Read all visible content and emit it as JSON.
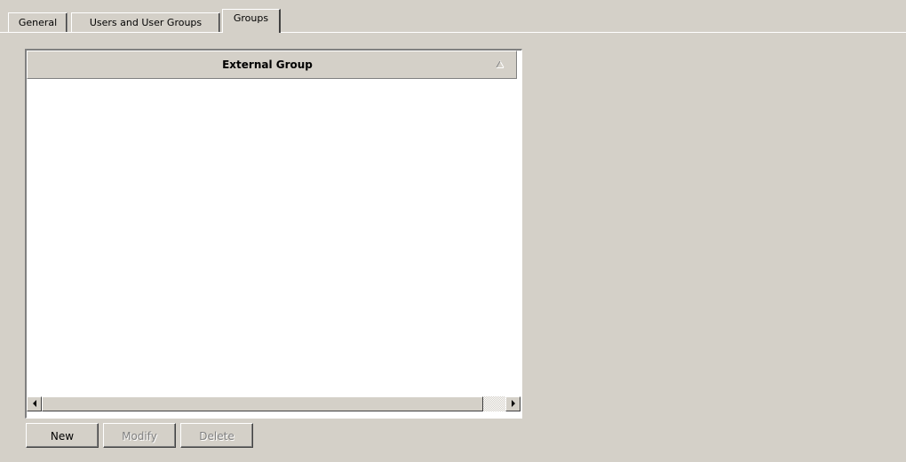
{
  "tabs": [
    {
      "label": "General",
      "active": false
    },
    {
      "label": "Users and User Groups",
      "active": false
    },
    {
      "label": "Groups",
      "active": true
    }
  ],
  "list": {
    "columns": [
      {
        "label": "External Group",
        "sort": "ascending"
      }
    ],
    "rows": []
  },
  "buttons": {
    "new_label": "New",
    "modify_label": "Modify",
    "delete_label": "Delete"
  },
  "icons": {
    "sort": "sort-ascending-icon",
    "scroll_left": "scroll-left-arrow-icon",
    "scroll_right": "scroll-right-arrow-icon"
  },
  "colors": {
    "background": "#d4d0c8",
    "list_background": "#ffffff",
    "disabled_text": "#808080"
  }
}
